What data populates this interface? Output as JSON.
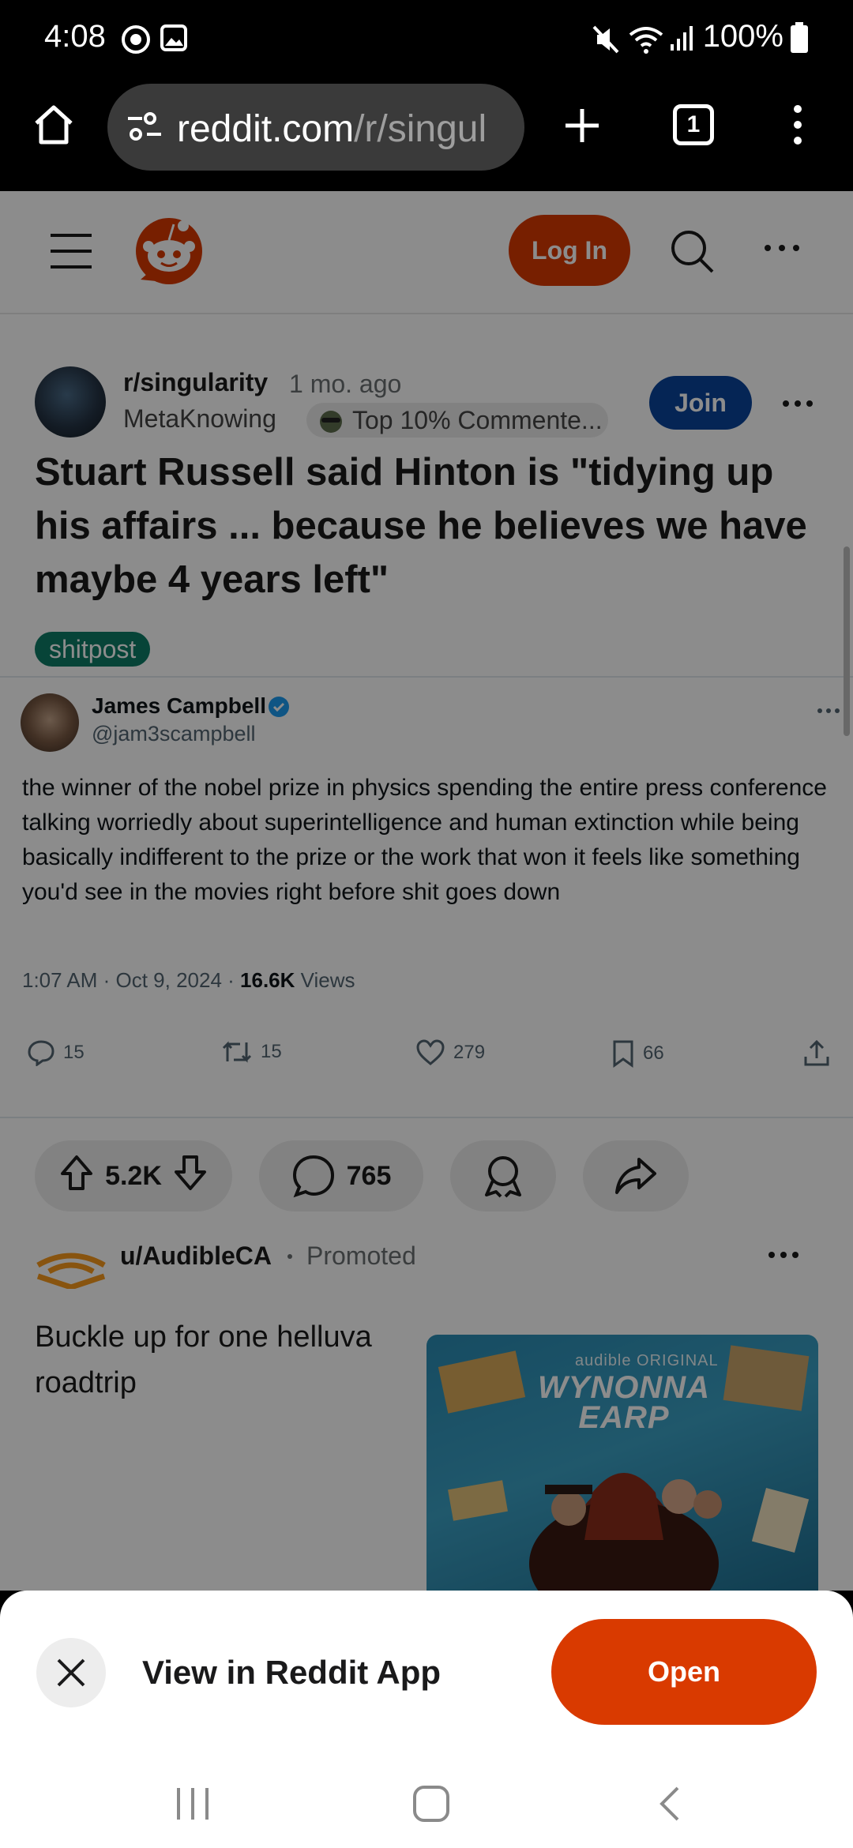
{
  "status_bar": {
    "time": "4:08",
    "battery": "100%"
  },
  "browser": {
    "url_domain": "reddit.com",
    "url_path": "/r/singul",
    "tab_count": "1"
  },
  "reddit_header": {
    "login_label": "Log In"
  },
  "post": {
    "subreddit": "r/singularity",
    "age": "1 mo. ago",
    "author": "MetaKnowing",
    "author_flair": "Top 10% Commente...",
    "join_label": "Join",
    "title": "Stuart Russell said Hinton is \"tidying up his affairs ... because he believes we have maybe 4 years left\"",
    "flair": "shitpost",
    "upvotes": "5.2K",
    "comments": "765"
  },
  "tweet": {
    "name": "James Campbell",
    "handle": "@jam3scampbell",
    "body": "the winner of the nobel prize in physics spending the entire press conference talking worriedly about superintelligence and human extinction while being basically indifferent to the prize or the work that won it feels like something you'd see in the movies right before shit goes down",
    "time": "1:07 AM · Oct 9, 2024 · ",
    "views_count": "16.6K",
    "views_label": " Views",
    "replies": "15",
    "retweets": "15",
    "likes": "279",
    "bookmarks": "66"
  },
  "ad": {
    "user": "u/AudibleCA",
    "promoted": "Promoted",
    "text": "Buckle up for one helluva roadtrip",
    "image_brand": "audible ORIGINAL",
    "image_title_line1": "WYNONNA",
    "image_title_line2": "EARP"
  },
  "sheet": {
    "title": "View in Reddit App",
    "open_label": "Open"
  },
  "colors": {
    "reddit_orange": "#d93a00",
    "join_blue": "#0a449b",
    "flair_green": "#0d7c66"
  }
}
